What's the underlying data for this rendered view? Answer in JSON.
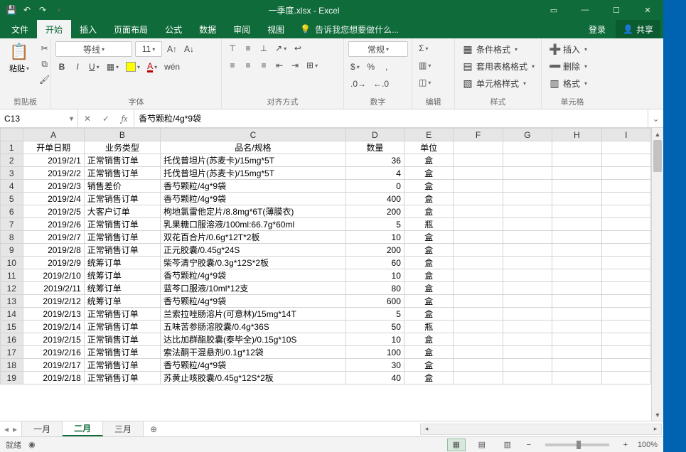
{
  "titlebar": {
    "title": "一季度.xlsx - Excel"
  },
  "tabs": {
    "file": "文件",
    "home": "开始",
    "insert": "插入",
    "layout": "页面布局",
    "formulas": "公式",
    "data": "数据",
    "review": "审阅",
    "view": "视图",
    "tell": "告诉我您想要做什么...",
    "login": "登录",
    "share": "共享"
  },
  "ribbon": {
    "clipboard": {
      "paste": "粘贴",
      "group": "剪贴板"
    },
    "font": {
      "name": "等线",
      "size": "11",
      "group": "字体"
    },
    "align": {
      "group": "对齐方式"
    },
    "number": {
      "format": "常规",
      "group": "数字"
    },
    "styles": {
      "cond": "条件格式",
      "table": "套用表格格式",
      "cell": "单元格样式",
      "group": "样式"
    },
    "cells": {
      "insert": "插入",
      "delete": "删除",
      "format": "格式",
      "group": "单元格"
    },
    "editing": {
      "group": "编辑"
    }
  },
  "fx": {
    "name": "C13",
    "formula": "香芍颗粒/4g*9袋"
  },
  "cols": [
    "",
    "A",
    "B",
    "C",
    "D",
    "E",
    "F",
    "G",
    "H",
    "I"
  ],
  "header": {
    "A": "开单日期",
    "B": "业务类型",
    "C": "品名/规格",
    "D": "数量",
    "E": "单位"
  },
  "rows": [
    {
      "n": 2,
      "A": "2019/2/1",
      "B": "正常销售订单",
      "C": "托伐普坦片(苏麦卡)/15mg*5T",
      "D": "36",
      "E": "盒"
    },
    {
      "n": 3,
      "A": "2019/2/2",
      "B": "正常销售订单",
      "C": "托伐普坦片(苏麦卡)/15mg*5T",
      "D": "4",
      "E": "盒"
    },
    {
      "n": 4,
      "A": "2019/2/3",
      "B": "销售差价",
      "C": "香芍颗粒/4g*9袋",
      "D": "0",
      "E": "盒"
    },
    {
      "n": 5,
      "A": "2019/2/4",
      "B": "正常销售订单",
      "C": "香芍颗粒/4g*9袋",
      "D": "400",
      "E": "盒"
    },
    {
      "n": 6,
      "A": "2019/2/5",
      "B": "大客户订单",
      "C": "枸地氯雷他定片/8.8mg*6T(薄膜衣)",
      "D": "200",
      "E": "盒"
    },
    {
      "n": 7,
      "A": "2019/2/6",
      "B": "正常销售订单",
      "C": "乳果糖口服溶液/100ml:66.7g*60ml",
      "D": "5",
      "E": "瓶"
    },
    {
      "n": 8,
      "A": "2019/2/7",
      "B": "正常销售订单",
      "C": "双花百合片/0.6g*12T*2板",
      "D": "10",
      "E": "盒"
    },
    {
      "n": 9,
      "A": "2019/2/8",
      "B": "正常销售订单",
      "C": "正元胶囊/0.45g*24S",
      "D": "200",
      "E": "盒"
    },
    {
      "n": 10,
      "A": "2019/2/9",
      "B": "统筹订单",
      "C": "柴芩清宁胶囊/0.3g*12S*2板",
      "D": "60",
      "E": "盒"
    },
    {
      "n": 11,
      "A": "2019/2/10",
      "B": "统筹订单",
      "C": "香芍颗粒/4g*9袋",
      "D": "10",
      "E": "盒"
    },
    {
      "n": 12,
      "A": "2019/2/11",
      "B": "统筹订单",
      "C": "蓝芩口服液/10ml*12支",
      "D": "80",
      "E": "盒"
    },
    {
      "n": 13,
      "A": "2019/2/12",
      "B": "统筹订单",
      "C": "香芍颗粒/4g*9袋",
      "D": "600",
      "E": "盒"
    },
    {
      "n": 14,
      "A": "2019/2/13",
      "B": "正常销售订单",
      "C": "兰索拉唑肠溶片(可意林)/15mg*14T",
      "D": "5",
      "E": "盒"
    },
    {
      "n": 15,
      "A": "2019/2/14",
      "B": "正常销售订单",
      "C": "五味苦参肠溶胶囊/0.4g*36S",
      "D": "50",
      "E": "瓶"
    },
    {
      "n": 16,
      "A": "2019/2/15",
      "B": "正常销售订单",
      "C": "达比加群酯胶囊(泰毕全)/0.15g*10S",
      "D": "10",
      "E": "盒"
    },
    {
      "n": 17,
      "A": "2019/2/16",
      "B": "正常销售订单",
      "C": "索法酮干混悬剂/0.1g*12袋",
      "D": "100",
      "E": "盒"
    },
    {
      "n": 18,
      "A": "2019/2/17",
      "B": "正常销售订单",
      "C": "香芍颗粒/4g*9袋",
      "D": "30",
      "E": "盒"
    },
    {
      "n": 19,
      "A": "2019/2/18",
      "B": "正常销售订单",
      "C": "苏黄止咳胶囊/0.45g*12S*2板",
      "D": "40",
      "E": "盒"
    }
  ],
  "sheets": {
    "s1": "一月",
    "s2": "二月",
    "s3": "三月"
  },
  "status": {
    "ready": "就绪",
    "rec": "",
    "zoom": "100%"
  }
}
